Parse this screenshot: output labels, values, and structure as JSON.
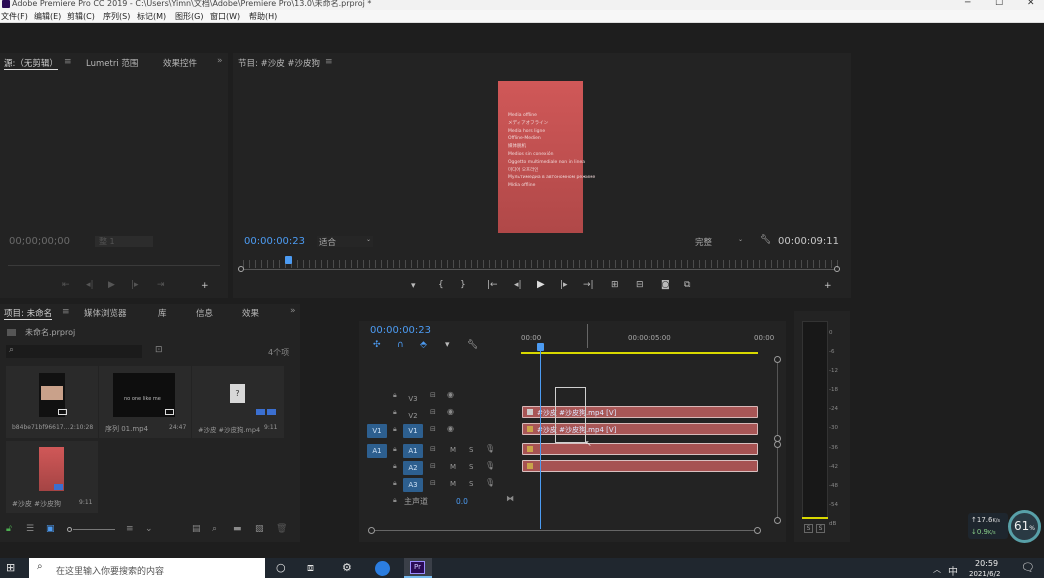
{
  "window": {
    "title": "Adobe Premiere Pro CC 2019 - C:\\Users\\Yimn\\文档\\Adobe\\Premiere Pro\\13.0\\未命名.prproj *",
    "min": "─",
    "max": "☐",
    "close": "✕"
  },
  "menu": [
    "文件(F)",
    "编辑(E)",
    "剪辑(C)",
    "序列(S)",
    "标记(M)",
    "图形(G)",
    "窗口(W)",
    "帮助(H)"
  ],
  "source_panel": {
    "tabs": [
      "源:（无剪辑）",
      "Lumetri 范围",
      "效果控件"
    ],
    "menu_icon": "≡",
    "overflow": "»",
    "timecode": "00;00;00;00",
    "fit": "整 1"
  },
  "program_panel": {
    "tab": "节目: #沙皮 #沙皮狗",
    "menu_icon": "≡",
    "timecode": "00:00:00:23",
    "fit": "适合",
    "quality": "完整",
    "duration": "00:00:09:11",
    "overlay_lines": [
      "Media offline",
      "メディアオフライン",
      "Media hors ligne",
      "Offline-Medien",
      "媒体脱机",
      "Medios sin conexión",
      "Oggetto multimediale non in linea",
      "미디어 오프라인",
      "Мультимедиа в автономном режиме",
      "Mídia offline"
    ]
  },
  "project_panel": {
    "tabs": [
      "项目: 未命名",
      "媒体浏览器",
      "库",
      "信息",
      "效果"
    ],
    "menu_icon": "≡",
    "overflow": "»",
    "project_file": "未命名.prproj",
    "item_count": "4个项",
    "items": [
      {
        "name": "b84be71bf96617...",
        "duration": "2:10:28",
        "thumb_text": ""
      },
      {
        "name": "序列 01.mp4",
        "duration": "24:47",
        "thumb_text": "no one like me"
      },
      {
        "name": "#沙皮 #沙皮狗.mp4",
        "duration": "9:11",
        "thumb_text": "?"
      },
      {
        "name": "#沙皮 #沙皮狗",
        "duration": "9:11",
        "thumb_text": ""
      }
    ]
  },
  "timeline": {
    "timecode": "00:00:00:23",
    "ruler": [
      "00:00",
      "00:00:05:00",
      "00:00"
    ],
    "video_tracks": [
      {
        "target": "",
        "name": "V3"
      },
      {
        "target": "",
        "name": "V2"
      },
      {
        "target": "V1",
        "name": "V1"
      }
    ],
    "audio_tracks": [
      {
        "target": "A1",
        "name": "A1"
      },
      {
        "target": "",
        "name": "A2"
      },
      {
        "target": "",
        "name": "A3"
      }
    ],
    "master": {
      "label": "主声道",
      "value": "0.0"
    },
    "clips": [
      "#沙皮 #沙皮狗.mp4 [V]",
      "#沙皮 #沙皮狗.mp4 [V]"
    ],
    "mute": "M",
    "solo": "S"
  },
  "meter": {
    "scale": [
      "0",
      "-6",
      "-12",
      "-18",
      "-24",
      "-30",
      "-36",
      "-42",
      "-48",
      "-54",
      "dB"
    ],
    "solo": [
      "S",
      "S"
    ]
  },
  "net_widget": {
    "up": "17.6",
    "down": "0.9",
    "unit": "K/s",
    "percent": "61"
  },
  "taskbar": {
    "search_placeholder": "在这里输入你要搜索的内容",
    "app_label": "Pr",
    "tray_ime": "中",
    "tray_arrow": "︿",
    "time": "20:59",
    "date": "2021/6/2"
  },
  "colors": {
    "accent_blue": "#4c9bf2",
    "clip_red": "#a85656",
    "audio_clip": "#a65252",
    "work_area": "#d8d800",
    "panel_bg": "#232323",
    "app_bg": "#1e1e1e"
  }
}
